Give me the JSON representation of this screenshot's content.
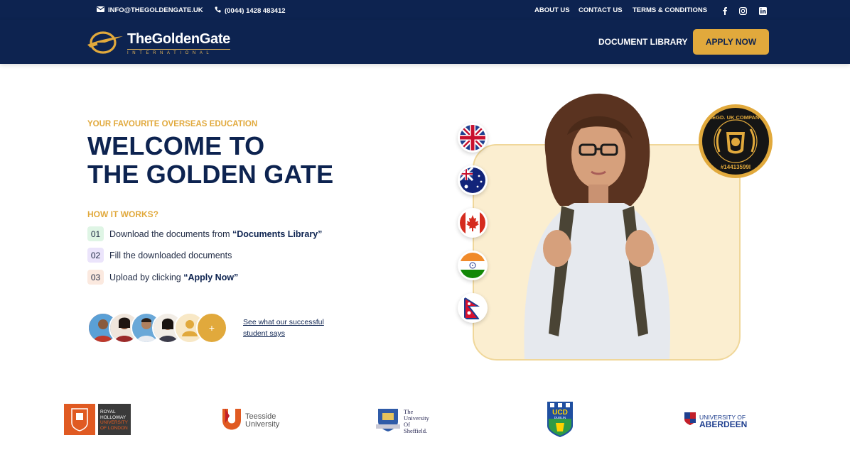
{
  "topbar": {
    "email": "INFO@THEGOLDENGATE.UK",
    "phone": "(0044) 1428 483412",
    "links": [
      "ABOUT US",
      "CONTACT US",
      "TERMS & CONDITIONS"
    ],
    "social_icons": [
      "facebook-icon",
      "instagram-icon",
      "linkedin-icon"
    ]
  },
  "nav": {
    "logo_main": "TheGoldenGate",
    "logo_sub": "INTERNATIONAL",
    "document_library": "DOCUMENT LIBRARY",
    "apply_now": "APPLY NOW"
  },
  "hero": {
    "eyebrow": "YOUR FAVOURITE OVERSEAS EDUCATION",
    "title_line1": "WELCOME TO",
    "title_line2": "THE GOLDEN GATE",
    "how_heading": "HOW IT WORKS?",
    "steps": [
      {
        "num": "01",
        "text": "Download the documents from ",
        "bold": "“Documents Library”"
      },
      {
        "num": "02",
        "text": "Fill the downloaded documents",
        "bold": ""
      },
      {
        "num": "03",
        "text": "Upload by clicking ",
        "bold": "“Apply Now”"
      }
    ],
    "avatar_plus": "+",
    "testimonial_link": "See what our successful student says"
  },
  "seal": {
    "top_text": "REGD. UK COMPANY",
    "bottom_text": "#14413599I"
  },
  "flags": [
    "uk-flag-icon",
    "australia-flag-icon",
    "canada-flag-icon",
    "india-flag-icon",
    "nepal-flag-icon"
  ],
  "universities": {
    "royal_holloway": [
      "ROYAL",
      "HOLLOWAY",
      "UNIVERSITY",
      "OF LONDON"
    ],
    "teesside": [
      "Teesside",
      "University"
    ],
    "sheffield": [
      "The",
      "University",
      "Of",
      "Sheffield."
    ],
    "ucd": [
      "UCD",
      "DUBLIN"
    ],
    "aberdeen": [
      "UNIVERSITY OF",
      "ABERDEEN"
    ]
  },
  "colors": {
    "navy": "#0d2350",
    "gold": "#e1a93c",
    "card": "#fbeed0"
  }
}
